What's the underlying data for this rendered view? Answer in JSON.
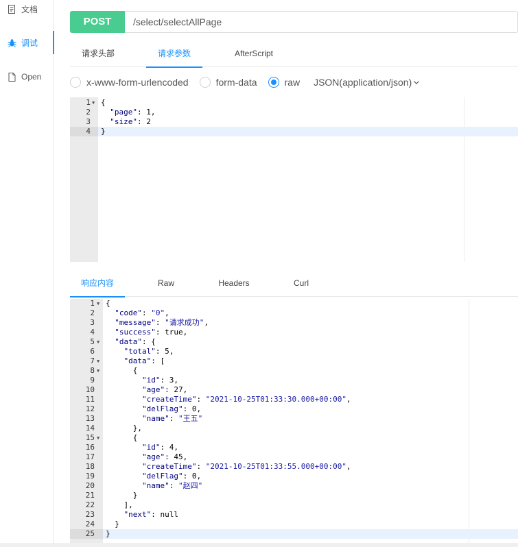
{
  "sidebar": {
    "items": [
      {
        "label": "文档"
      },
      {
        "label": "调试"
      },
      {
        "label": "Open"
      }
    ]
  },
  "request": {
    "method": "POST",
    "url": "/select/selectAllPage"
  },
  "request_tabs": [
    {
      "label": "请求头部"
    },
    {
      "label": "请求参数"
    },
    {
      "label": "AfterScript"
    }
  ],
  "body_types": [
    {
      "label": "x-www-form-urlencoded"
    },
    {
      "label": "form-data"
    },
    {
      "label": "raw"
    }
  ],
  "content_type": "JSON(application/json)",
  "request_body": {
    "lines": [
      [
        {
          "t": "p",
          "v": "{"
        }
      ],
      [
        {
          "t": "p",
          "v": "  "
        },
        {
          "t": "k",
          "v": "\"page\""
        },
        {
          "t": "p",
          "v": ": 1,"
        }
      ],
      [
        {
          "t": "p",
          "v": "  "
        },
        {
          "t": "k",
          "v": "\"size\""
        },
        {
          "t": "p",
          "v": ": 2"
        }
      ],
      [
        {
          "t": "p",
          "v": "}"
        }
      ]
    ]
  },
  "response_tabs": [
    {
      "label": "响应内容"
    },
    {
      "label": "Raw"
    },
    {
      "label": "Headers"
    },
    {
      "label": "Curl"
    }
  ],
  "response_body": {
    "lines": [
      [
        {
          "t": "p",
          "v": "{"
        }
      ],
      [
        {
          "t": "p",
          "v": "  "
        },
        {
          "t": "k",
          "v": "\"code\""
        },
        {
          "t": "p",
          "v": ": "
        },
        {
          "t": "s",
          "v": "\"0\""
        },
        {
          "t": "p",
          "v": ","
        }
      ],
      [
        {
          "t": "p",
          "v": "  "
        },
        {
          "t": "k",
          "v": "\"message\""
        },
        {
          "t": "p",
          "v": ": "
        },
        {
          "t": "s",
          "v": "\"请求成功\""
        },
        {
          "t": "p",
          "v": ","
        }
      ],
      [
        {
          "t": "p",
          "v": "  "
        },
        {
          "t": "k",
          "v": "\"success\""
        },
        {
          "t": "p",
          "v": ": true,"
        }
      ],
      [
        {
          "t": "p",
          "v": "  "
        },
        {
          "t": "k",
          "v": "\"data\""
        },
        {
          "t": "p",
          "v": ": {"
        }
      ],
      [
        {
          "t": "p",
          "v": "    "
        },
        {
          "t": "k",
          "v": "\"total\""
        },
        {
          "t": "p",
          "v": ": 5,"
        }
      ],
      [
        {
          "t": "p",
          "v": "    "
        },
        {
          "t": "k",
          "v": "\"data\""
        },
        {
          "t": "p",
          "v": ": ["
        }
      ],
      [
        {
          "t": "p",
          "v": "      {"
        }
      ],
      [
        {
          "t": "p",
          "v": "        "
        },
        {
          "t": "k",
          "v": "\"id\""
        },
        {
          "t": "p",
          "v": ": 3,"
        }
      ],
      [
        {
          "t": "p",
          "v": "        "
        },
        {
          "t": "k",
          "v": "\"age\""
        },
        {
          "t": "p",
          "v": ": 27,"
        }
      ],
      [
        {
          "t": "p",
          "v": "        "
        },
        {
          "t": "k",
          "v": "\"createTime\""
        },
        {
          "t": "p",
          "v": ": "
        },
        {
          "t": "s",
          "v": "\"2021-10-25T01:33:30.000+00:00\""
        },
        {
          "t": "p",
          "v": ","
        }
      ],
      [
        {
          "t": "p",
          "v": "        "
        },
        {
          "t": "k",
          "v": "\"delFlag\""
        },
        {
          "t": "p",
          "v": ": 0,"
        }
      ],
      [
        {
          "t": "p",
          "v": "        "
        },
        {
          "t": "k",
          "v": "\"name\""
        },
        {
          "t": "p",
          "v": ": "
        },
        {
          "t": "s",
          "v": "\"王五\""
        }
      ],
      [
        {
          "t": "p",
          "v": "      },"
        }
      ],
      [
        {
          "t": "p",
          "v": "      {"
        }
      ],
      [
        {
          "t": "p",
          "v": "        "
        },
        {
          "t": "k",
          "v": "\"id\""
        },
        {
          "t": "p",
          "v": ": 4,"
        }
      ],
      [
        {
          "t": "p",
          "v": "        "
        },
        {
          "t": "k",
          "v": "\"age\""
        },
        {
          "t": "p",
          "v": ": 45,"
        }
      ],
      [
        {
          "t": "p",
          "v": "        "
        },
        {
          "t": "k",
          "v": "\"createTime\""
        },
        {
          "t": "p",
          "v": ": "
        },
        {
          "t": "s",
          "v": "\"2021-10-25T01:33:55.000+00:00\""
        },
        {
          "t": "p",
          "v": ","
        }
      ],
      [
        {
          "t": "p",
          "v": "        "
        },
        {
          "t": "k",
          "v": "\"delFlag\""
        },
        {
          "t": "p",
          "v": ": 0,"
        }
      ],
      [
        {
          "t": "p",
          "v": "        "
        },
        {
          "t": "k",
          "v": "\"name\""
        },
        {
          "t": "p",
          "v": ": "
        },
        {
          "t": "s",
          "v": "\"赵四\""
        }
      ],
      [
        {
          "t": "p",
          "v": "      }"
        }
      ],
      [
        {
          "t": "p",
          "v": "    ],"
        }
      ],
      [
        {
          "t": "p",
          "v": "    "
        },
        {
          "t": "k",
          "v": "\"next\""
        },
        {
          "t": "p",
          "v": ": null"
        }
      ],
      [
        {
          "t": "p",
          "v": "  }"
        }
      ],
      [
        {
          "t": "p",
          "v": "}"
        }
      ]
    ]
  },
  "colors": {
    "accent": "#1890ff",
    "post_method": "#49cc90",
    "json_key": "#000080",
    "json_string": "#1a1aa6"
  }
}
